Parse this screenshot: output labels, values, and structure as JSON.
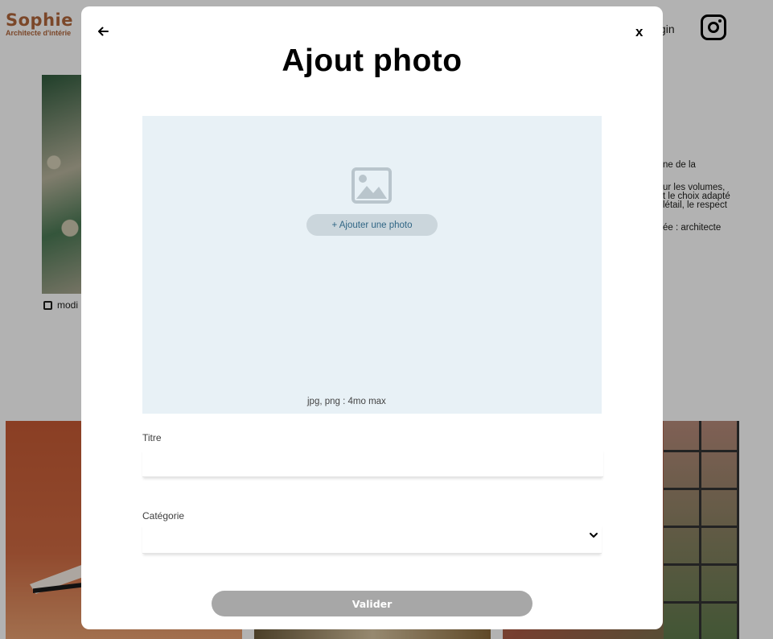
{
  "background": {
    "brand": {
      "name": "Sophie",
      "subtitle": "Architecte d'intérie"
    },
    "nav": {
      "login": "gin"
    },
    "project": {
      "edit_label": "modi"
    },
    "intro_lines": [
      "ne de la",
      "ur les volumes,",
      "t le choix adapté",
      "létail, le respect",
      "ée : architecte"
    ]
  },
  "modal": {
    "title": "Ajout photo",
    "close_label": "x",
    "dropzone": {
      "add_button_label": "+ Ajouter une photo",
      "hint": "jpg, png : 4mo max"
    },
    "title_field": {
      "label": "Titre",
      "value": "",
      "placeholder": ""
    },
    "category_field": {
      "label": "Catégorie",
      "value": ""
    },
    "submit_label": "Valider"
  },
  "colors": {
    "brand": "#b1663c",
    "dropzone_bg": "#e8f1f6",
    "add_button_bg": "#cbd6dc",
    "add_button_text": "#306685",
    "submit_disabled": "#a7a7a7"
  },
  "icons": {
    "back": "arrow-left-icon",
    "close": "close-icon",
    "upload": "image-icon",
    "select": "chevron-down-icon",
    "social": "instagram-icon",
    "edit": "edit-icon"
  }
}
